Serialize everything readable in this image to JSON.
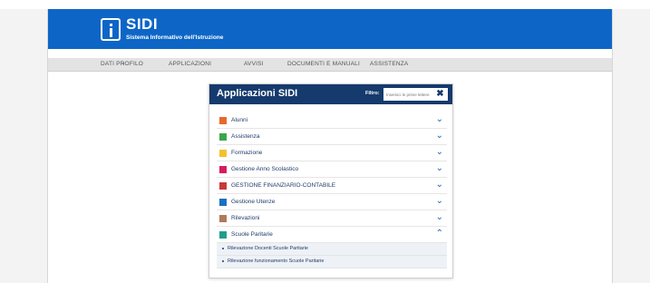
{
  "brand": {
    "title": "SIDI",
    "subtitle": "Sistema Informativo dell'Istruzione",
    "logo_icon": "info-icon"
  },
  "nav": {
    "items": [
      {
        "label": "DATI PROFILO",
        "has_dropdown": true
      },
      {
        "label": "APPLICAZIONI"
      },
      {
        "label": "AVVISI"
      },
      {
        "label": "DOCUMENTI E MANUALI"
      },
      {
        "label": "ASSISTENZA"
      }
    ]
  },
  "panel": {
    "title": "Applicazioni SIDI",
    "filter_label": "Filtro:",
    "filter_placeholder": "Inserisci le prime lettere",
    "clear_icon": "close-icon"
  },
  "apps": [
    {
      "label": "Alunni",
      "color": "#e8682a",
      "expanded": false
    },
    {
      "label": "Assistenza",
      "color": "#3aa64b",
      "expanded": false
    },
    {
      "label": "Formazione",
      "color": "#f2c12e",
      "expanded": false
    },
    {
      "label": "Gestione Anno Scolastico",
      "color": "#d81b60",
      "expanded": false
    },
    {
      "label": "GESTIONE FINANZIARIO-CONTABILE",
      "color": "#c73a3a",
      "expanded": false
    },
    {
      "label": "Gestione Utenze",
      "color": "#1b6fc0",
      "expanded": false
    },
    {
      "label": "Rilevazioni",
      "color": "#b07a5a",
      "expanded": false
    },
    {
      "label": "Scuole Paritarie",
      "color": "#1f9e8a",
      "expanded": true,
      "children": [
        {
          "label": "Rilevazione Docenti Scuole Paritarie"
        },
        {
          "label": "Rilevazione funzionamento Scuole Paritarie"
        }
      ]
    }
  ],
  "colors": {
    "header": "#0d66c6",
    "panel_header": "#153a6d",
    "chevron": "#1b63b5"
  }
}
